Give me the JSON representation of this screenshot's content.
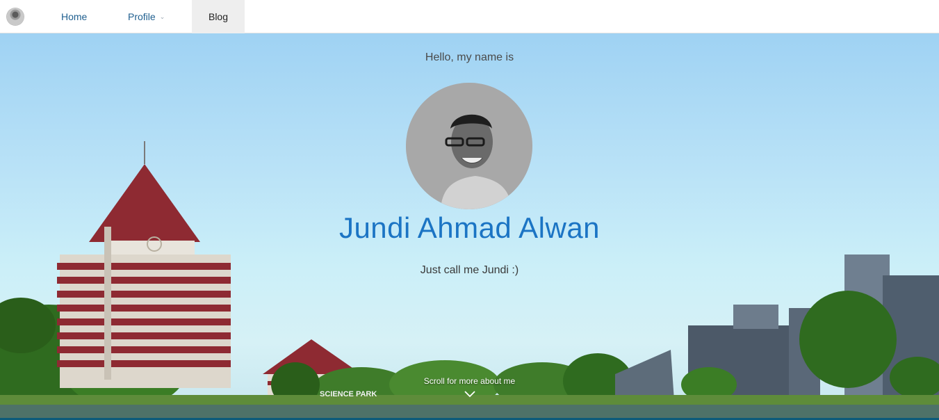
{
  "navbar": {
    "avatar_icon": "avatar-icon",
    "links": [
      {
        "label": "Home"
      },
      {
        "label": "Profile",
        "has_dropdown": true,
        "dropdown_icon": "chevron-down-icon"
      },
      {
        "label": "Blog",
        "active": true
      }
    ]
  },
  "hero": {
    "greeting": "Hello, my name is",
    "name": "Jundi Ahmad Alwan",
    "tagline": "Just call me Jundi :)",
    "scroll_hint": "Scroll for more about me",
    "scroll_icon": "chevron-down-icon",
    "background_sign": "SCIENCE PARK"
  },
  "colors": {
    "name_blue": "#1b74c4",
    "nav_link": "#1f5f8f",
    "nav_active_bg": "#eeeeee",
    "roof_red": "#8e2a32"
  }
}
